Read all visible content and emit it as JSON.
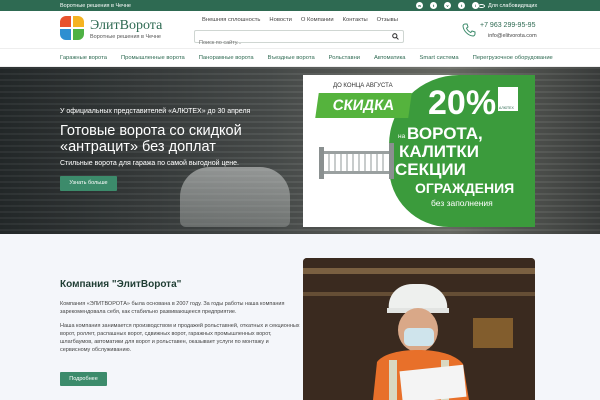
{
  "topbar": {
    "tagline": "Воротные решения в Чечне",
    "social": [
      "whatsapp-icon",
      "telegram-icon",
      "vk-icon",
      "telegram-icon",
      "instagram-icon"
    ],
    "accessibility_label": "Для слабовидящих"
  },
  "header": {
    "logo_name": "ЭлитВорота",
    "logo_slogan": "Воротные решения в Чечне",
    "top_links": [
      "Внешняя сплошность",
      "Новости",
      "О Компании",
      "Контакты",
      "Отзывы"
    ],
    "search_placeholder": "Поиск по сайту...",
    "phone": "+7 963 299-95-95",
    "email": "info@elitvorota.com"
  },
  "main_nav": [
    "Гаражные ворота",
    "Промышленные ворота",
    "Панорамные ворота",
    "Въездные ворота",
    "Рольставни",
    "Автоматика",
    "Smart система",
    "Перегрузочное оборудование"
  ],
  "hero": {
    "pretitle": "У официальных представителей «АЛЮТЕХ» до 30 апреля",
    "title": "Готовые ворота со скидкой «антрацит» без доплат",
    "subtitle": "Стильные ворота для гаража по самой выгодной цене.",
    "button": "Узнать больше"
  },
  "promo": {
    "until": "ДО КОНЦА АВГУСТА",
    "discount_word": "СКИДКА",
    "percent": "20%",
    "brand": "АЛЮТЕХ",
    "on": "на",
    "line1": "ВОРОТА,",
    "line2": "КАЛИТКИ",
    "and": "и",
    "line3": "СЕКЦИИ",
    "line4": "ОГРАЖДЕНИЯ",
    "line5": "без заполнения"
  },
  "about": {
    "title": "Компания \"ЭлитВорота\"",
    "p1": "Компания «ЭЛИТВОРОТА» была основана в 2007 году. За годы работы наша компания зарекомендовала себя, как стабильно развивающееся предприятие.",
    "p2": "Наша компания занимается производством и продажей рольставней, откатных и секционных ворот, роллет, распашных ворот, сдвижных ворот, гаражных промышленных ворот, шлагбаумов, автоматики для ворот и рольставен, оказывает услуги по монтажу и сервисному обслуживанию.",
    "button": "Подробнее"
  },
  "colors": {
    "brand_green": "#2e6a52",
    "button_green": "#3c8b6b",
    "promo_green": "#3b9b3c"
  }
}
